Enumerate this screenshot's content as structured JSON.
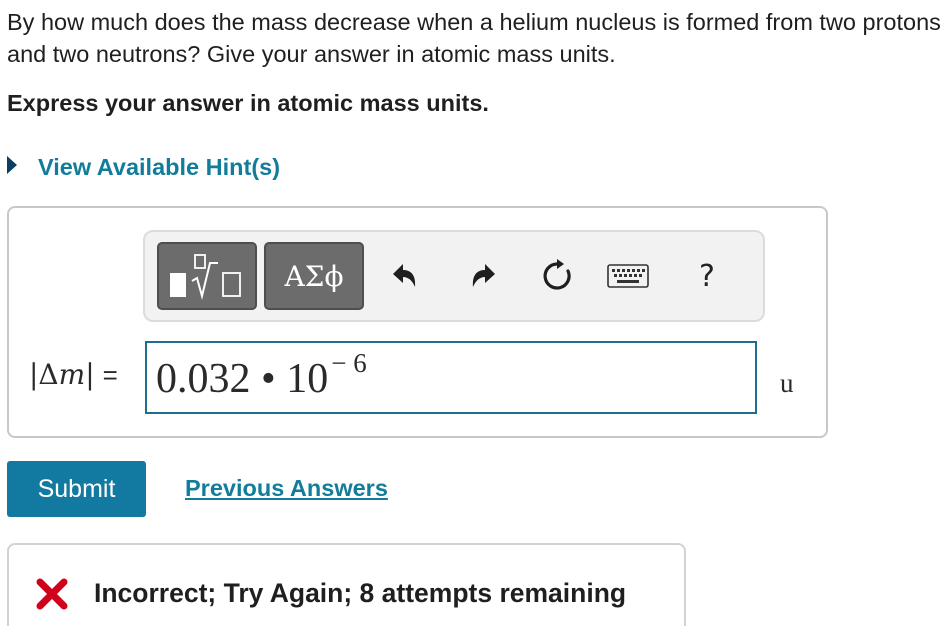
{
  "question": {
    "text": "By how much does the mass decrease when a helium nucleus is formed from two protons and two neutrons? Give your answer in atomic mass units.",
    "instruction": "Express your answer in atomic mass units."
  },
  "hint": {
    "label": "View Available Hint(s)"
  },
  "toolbar": {
    "symbols_label": "ΑΣϕ",
    "help_label": "?",
    "icons": [
      "templates-icon",
      "undo-icon",
      "redo-icon",
      "reset-icon",
      "keyboard-icon"
    ]
  },
  "answer": {
    "label_open": "|Δ",
    "label_var": "m",
    "label_close": "|",
    "equals": "=",
    "value_mantissa": "0.032 • 10",
    "value_exponent": "− 6",
    "unit": "u"
  },
  "actions": {
    "submit_label": "Submit",
    "previous_answers_label": "Previous Answers"
  },
  "feedback": {
    "message": "Incorrect; Try Again; 8 attempts remaining",
    "status": "incorrect",
    "status_color": "#d0021b"
  },
  "colors": {
    "accent": "#127aa0",
    "link": "#117d9a"
  }
}
